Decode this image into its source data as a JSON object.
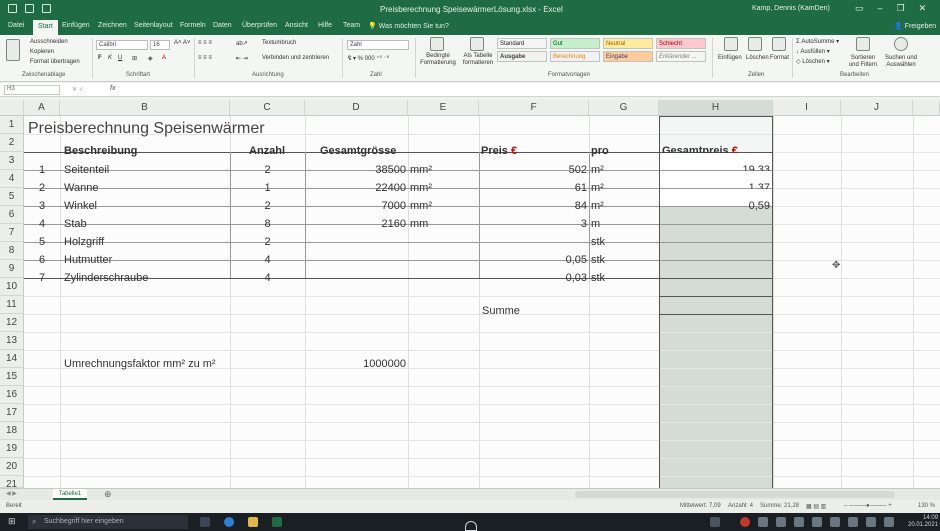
{
  "window": {
    "title": "Preisberechnung SpeisewärmerLösung.xlsx  -  Excel",
    "user": "Kamp, Dennis (KamDen)"
  },
  "ribbon_tabs": [
    "Datei",
    "Start",
    "Einfügen",
    "Zeichnen",
    "Seitenlayout",
    "Formeln",
    "Daten",
    "Überprüfen",
    "Ansicht",
    "Hilfe",
    "Team"
  ],
  "tell_me": "Was möchten Sie tun?",
  "share": "Freigeben",
  "ribbon": {
    "clipboard": [
      "Ausschneiden",
      "Kopieren",
      "Format übertragen"
    ],
    "clipboard_label": "Zwischenablage",
    "font_name": "Calibri",
    "font_size": "16",
    "font_label": "Schriftart",
    "wrap_text": "Textumbruch",
    "merge": "Verbinden und zentrieren",
    "align_label": "Ausrichtung",
    "number_format": "Zahl",
    "number_label": "Zahl",
    "cond_format": "Bedingte Formatierung",
    "as_table": "Als Tabelle formatieren",
    "styles": [
      {
        "name": "Standard",
        "bg": "#ffffff",
        "fg": "#333333"
      },
      {
        "name": "Gut",
        "bg": "#c6efce",
        "fg": "#006100"
      },
      {
        "name": "Neutral",
        "bg": "#ffeb9c",
        "fg": "#9c6500"
      },
      {
        "name": "Schlecht",
        "bg": "#ffc7ce",
        "fg": "#9c0006"
      },
      {
        "name": "Ausgabe",
        "bg": "#f2f2f2",
        "fg": "#3f3f3f"
      },
      {
        "name": "Berechnung",
        "bg": "#f2f2f2",
        "fg": "#fa7d00"
      },
      {
        "name": "Eingabe",
        "bg": "#ffcc99",
        "fg": "#3f3f76"
      },
      {
        "name": "Erklärender ...",
        "bg": "#ffffff",
        "fg": "#7f7f7f"
      }
    ],
    "styles_label": "Formatvorlagen",
    "cells_buttons": [
      "Einfügen",
      "Löschen",
      "Format"
    ],
    "cells_label": "Zellen",
    "editing": [
      "AutoSumme",
      "Ausfüllen",
      "Löschen"
    ],
    "sort": "Sortieren und Filtern",
    "find": "Suchen und Auswählen",
    "editing_label": "Bearbeiten"
  },
  "formula_bar": {
    "name_box": "H3",
    "fx": "fx"
  },
  "columns": [
    "A",
    "B",
    "C",
    "D",
    "E",
    "F",
    "G",
    "H",
    "I",
    "J"
  ],
  "rows": [
    "1",
    "2",
    "3",
    "4",
    "5",
    "6",
    "7",
    "8",
    "9",
    "10",
    "11",
    "12",
    "13",
    "14",
    "15",
    "16",
    "17",
    "18",
    "19",
    "20",
    "21"
  ],
  "sheet": {
    "title": "Preisberechnung Speisenwärmer",
    "headers": {
      "beschreibung": "Beschreibung",
      "anzahl": "Anzahl",
      "gesamtgroesse": "Gesamtgrösse",
      "preis": "Preis",
      "pro": "pro",
      "gesamtpreis": "Gesamtpreis"
    },
    "euro_symbol": "€",
    "items": [
      {
        "nr": "1",
        "name": "Seitenteil",
        "anzahl": "2",
        "groesse": "38500",
        "einheit": "mm²",
        "preis": "502",
        "pro": "m²",
        "gesamt": "19,33"
      },
      {
        "nr": "2",
        "name": "Wanne",
        "anzahl": "1",
        "groesse": "22400",
        "einheit": "mm²",
        "preis": "61",
        "pro": "m²",
        "gesamt": "1,37"
      },
      {
        "nr": "3",
        "name": "Winkel",
        "anzahl": "2",
        "groesse": "7000",
        "einheit": "mm²",
        "preis": "84",
        "pro": "m²",
        "gesamt": "0,59"
      },
      {
        "nr": "4",
        "name": "Stab",
        "anzahl": "8",
        "groesse": "2160",
        "einheit": "mm",
        "preis": "3",
        "pro": "m",
        "gesamt": ""
      },
      {
        "nr": "5",
        "name": "Holzgriff",
        "anzahl": "2",
        "groesse": "",
        "einheit": "",
        "preis": "",
        "pro": "stk",
        "gesamt": ""
      },
      {
        "nr": "6",
        "name": "Hutmutter",
        "anzahl": "4",
        "groesse": "",
        "einheit": "",
        "preis": "0,05",
        "pro": "stk",
        "gesamt": ""
      },
      {
        "nr": "7",
        "name": "Zylinderschraube",
        "anzahl": "4",
        "groesse": "",
        "einheit": "",
        "preis": "0,03",
        "pro": "stk",
        "gesamt": ""
      }
    ],
    "summe_label": "Summe",
    "factor_label": "Umrechnungsfaktor mm² zu m²",
    "factor_value": "1000000"
  },
  "sheet_tab": "Tabelle1",
  "status": {
    "ready": "Bereit",
    "mittelwert": "Mittelwert: 7,09",
    "anzahl": "Anzahl: 4",
    "summe": "Summe: 21,28",
    "zoom": "130 %"
  },
  "taskbar": {
    "search_placeholder": "Suchbegriff hier eingeben",
    "time": "14:09",
    "date": "20.01.2021"
  }
}
